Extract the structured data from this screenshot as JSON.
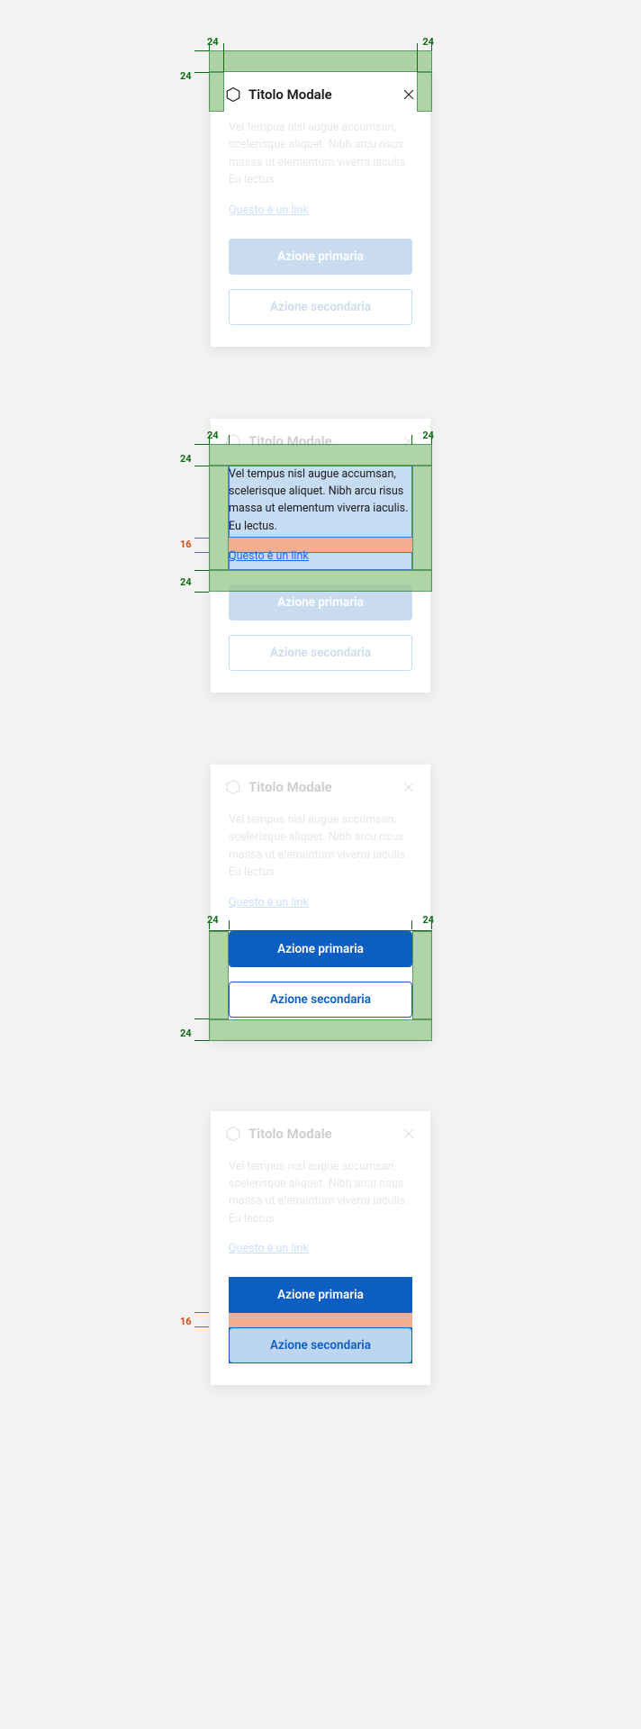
{
  "modal": {
    "title": "Titolo Modale",
    "body_text": "Vel tempus nisl augue accumsan, scelerisque aliquet. Nibh arcu risus massa ut elementum viverra iaculis. Eu lectus.",
    "link_label": "Questo è un link",
    "primary_label": "Azione primaria",
    "secondary_label": "Azione secondaria"
  },
  "spacings": {
    "header_pad_top": "24",
    "header_pad_side_left": "24",
    "header_pad_side_right": "24",
    "body_pad_top": "24",
    "body_pad_left": "24",
    "body_pad_right": "24",
    "body_pad_bottom": "24",
    "body_gap": "16",
    "actions_pad_left": "24",
    "actions_pad_right": "24",
    "actions_pad_bottom": "24",
    "actions_gap": "16"
  },
  "colors": {
    "primary": "#0d5ec1",
    "pad_overlay": "#99c98f",
    "gap_overlay": "#f0a587",
    "select_overlay": "#bcd6f2"
  }
}
